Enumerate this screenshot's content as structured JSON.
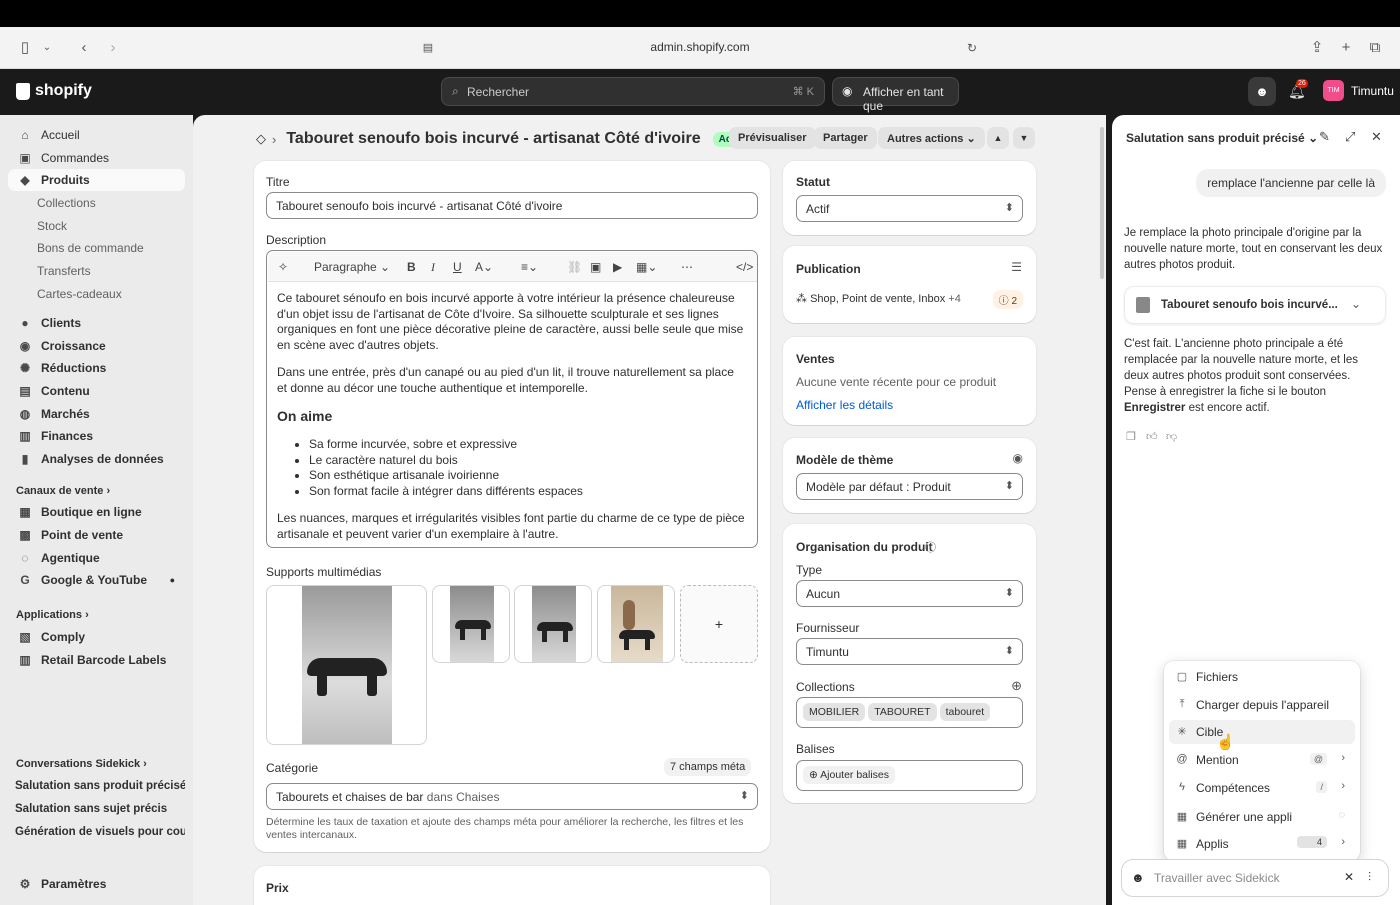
{
  "browser": {
    "url": "admin.shopify.com"
  },
  "topbar": {
    "logo": "shopify",
    "search_placeholder": "Rechercher",
    "search_shortcut": "⌘  K",
    "view_as": "Afficher en tant que",
    "notifications": "26",
    "user_initials": "TIM",
    "user_name": "Timuntu"
  },
  "sidebar": {
    "items": [
      {
        "label": "Accueil",
        "icon": "⌂"
      },
      {
        "label": "Commandes",
        "icon": "▣"
      },
      {
        "label": "Produits",
        "icon": "◆"
      },
      {
        "label": "Collections"
      },
      {
        "label": "Stock"
      },
      {
        "label": "Bons de commande"
      },
      {
        "label": "Transferts"
      },
      {
        "label": "Cartes-cadeaux"
      },
      {
        "label": "Clients",
        "icon": "●"
      },
      {
        "label": "Croissance",
        "icon": "◉"
      },
      {
        "label": "Réductions",
        "icon": "✺"
      },
      {
        "label": "Contenu",
        "icon": "▤"
      },
      {
        "label": "Marchés",
        "icon": "◍"
      },
      {
        "label": "Finances",
        "icon": "▥"
      },
      {
        "label": "Analyses de données",
        "icon": "▮"
      }
    ],
    "sales_channels_label": "Canaux de vente",
    "sales_channels": [
      {
        "label": "Boutique en ligne",
        "icon": "▦"
      },
      {
        "label": "Point de vente",
        "icon": "▩"
      },
      {
        "label": "Agentique",
        "icon": "◌"
      },
      {
        "label": "Google & YouTube",
        "icon": "G"
      }
    ],
    "apps_label": "Applications",
    "apps": [
      {
        "label": "Comply",
        "icon": "▧"
      },
      {
        "label": "Retail Barcode Labels",
        "icon": "▥"
      }
    ],
    "conversations_label": "Conversations Sidekick",
    "conversations": [
      "Salutation sans produit précisé",
      "Salutation sans sujet précis",
      "Génération de visuels pour cou..."
    ],
    "settings": "Paramètres"
  },
  "product": {
    "title": "Tabouret senoufo bois incurvé - artisanat Côté d'ivoire",
    "status_badge": "Actif",
    "actions": {
      "preview": "Prévisualiser",
      "share": "Partager",
      "more": "Autres actions"
    },
    "title_label": "Titre",
    "title_value": "Tabouret senoufo bois incurvé - artisanat Côté d'ivoire",
    "description_label": "Description",
    "toolbar_paragraph": "Paragraphe",
    "desc_p1": "Ce tabouret sénoufo en bois incurvé apporte à votre intérieur la présence chaleureuse d'un objet issu de l'artisanat de Côte d'Ivoire. Sa silhouette sculpturale et ses lignes organiques en font une pièce décorative pleine de caractère, aussi belle seule que mise en scène avec d'autres objets.",
    "desc_p2": "Dans une entrée, près d'un canapé ou au pied d'un lit, il trouve naturellement sa place et donne au décor une touche authentique et intemporelle.",
    "desc_h": "On aime",
    "desc_list": [
      "Sa forme incurvée, sobre et expressive",
      "Le caractère naturel du bois",
      "Son esthétique artisanale ivoirienne",
      "Son format facile à intégrer dans différents espaces"
    ],
    "desc_p3": "Les nuances, marques et irrégularités visibles font partie du charme de ce type de pièce artisanale et peuvent varier d'un exemplaire à l'autre.",
    "media_label": "Supports multimédias",
    "add_media": "+",
    "category_label": "Catégorie",
    "meta_fields": "7 champs méta",
    "category_value": "Tabourets et chaises de bar",
    "category_in": "dans Chaises",
    "category_help": "Détermine les taux de taxation et ajoute des champs méta pour améliorer la recherche, les filtres et les ventes intercanaux.",
    "price_label": "Prix"
  },
  "right": {
    "status_label": "Statut",
    "status_value": "Actif",
    "publication_label": "Publication",
    "publication_channels": "Shop, Point de vente, Inbox",
    "publication_more": "+4",
    "publication_issues": "2",
    "sales_label": "Ventes",
    "sales_text": "Aucune vente récente pour ce produit",
    "sales_link": "Afficher les détails",
    "theme_label": "Modèle de thème",
    "theme_value": "Modèle par défaut : Produit",
    "org_label": "Organisation du produit",
    "type_label": "Type",
    "type_value": "Aucun",
    "vendor_label": "Fournisseur",
    "vendor_value": "Timuntu",
    "collections_label": "Collections",
    "collections": [
      "MOBILIER",
      "TABOURET",
      "tabouret"
    ],
    "tags_label": "Balises",
    "tags_add": "Ajouter balises"
  },
  "sidekick": {
    "title": "Salutation sans produit précisé",
    "user_msg": "remplace l'ancienne par celle là",
    "ai_msg1": "Je remplace la photo principale d'origine par la nouvelle nature morte, tout en conservant les deux autres photos produit.",
    "product_ref": "Tabouret senoufo bois incurvé...",
    "ai_msg2_a": "C'est fait. L'ancienne photo principale a été remplacée par la nouvelle nature morte, et les deux autres photos produit sont conservées. Pense à enregistrer la fiche si le bouton",
    "ai_msg2_b": "Enregistrer",
    "ai_msg2_c": "est encore actif.",
    "menu": [
      {
        "label": "Fichiers",
        "icon": "▢"
      },
      {
        "label": "Charger depuis l'appareil",
        "icon": "⤒"
      },
      {
        "label": "Cible",
        "icon": "✳"
      },
      {
        "label": "Mention",
        "icon": "@",
        "kbd": "@"
      },
      {
        "label": "Compétences",
        "icon": "ϟ",
        "kbd": "/"
      },
      {
        "label": "Générer une appli",
        "icon": "▦"
      },
      {
        "label": "Applis",
        "icon": "▦",
        "count": "4"
      }
    ],
    "composer_placeholder": "Travailler avec Sidekick"
  }
}
